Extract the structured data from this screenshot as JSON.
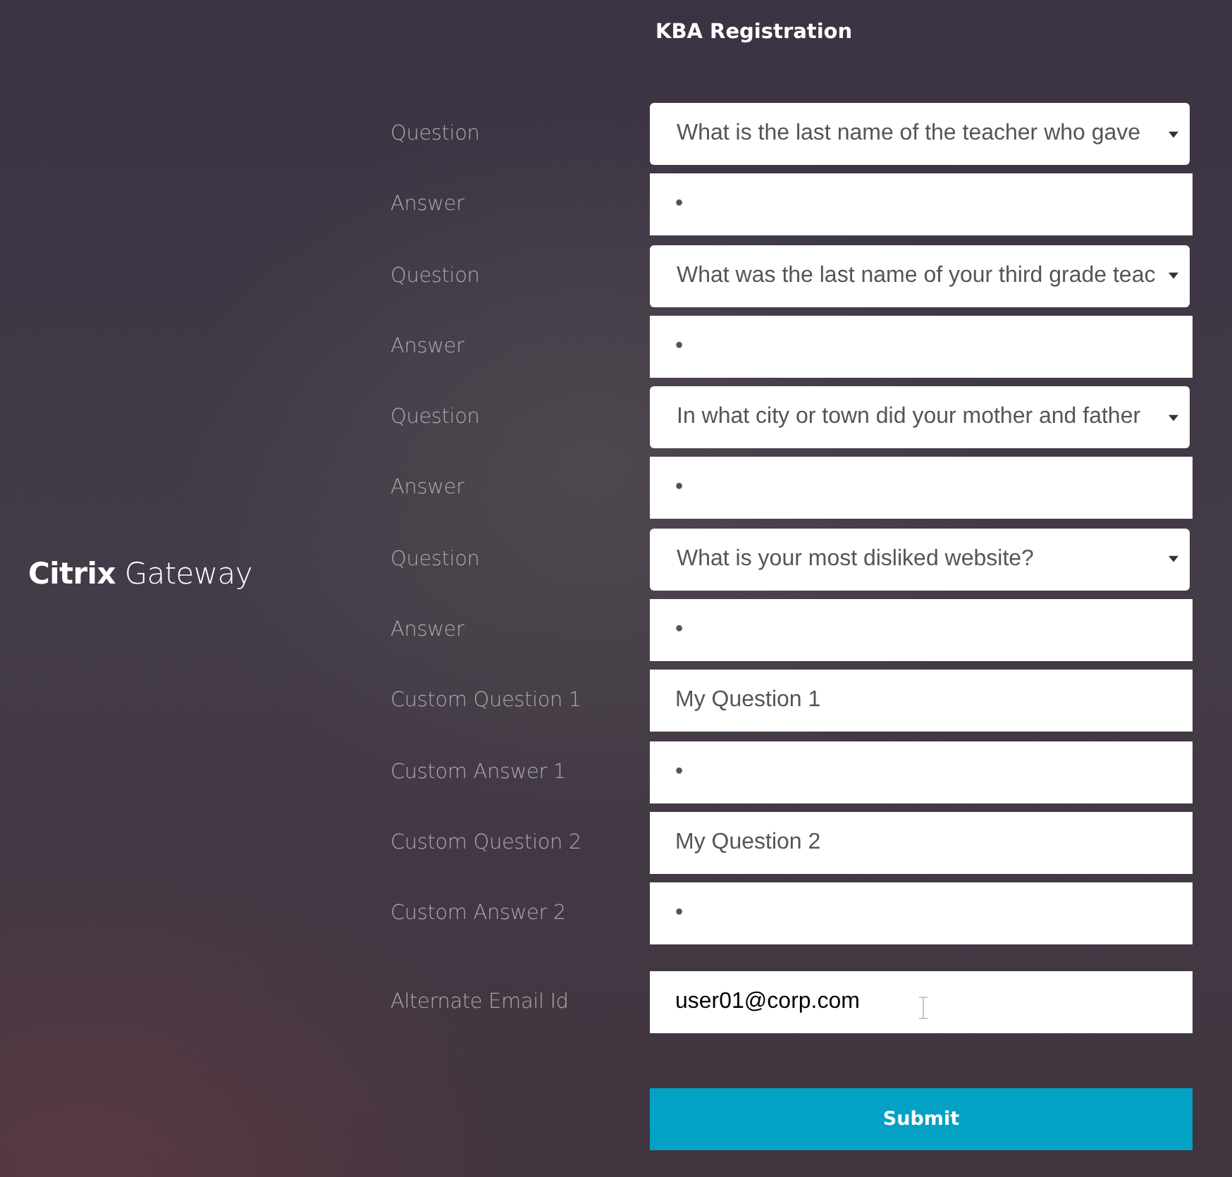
{
  "brand": "**Citrix** Gateway",
  "title": "KBA Registration",
  "fields": [
    {
      "kind": "select",
      "label": "Question",
      "value": "What is the last name of the teacher who gave"
    },
    {
      "kind": "password",
      "label": "Answer",
      "value": "•"
    },
    {
      "kind": "select",
      "label": "Question",
      "value": "What was the last name of your third grade teac"
    },
    {
      "kind": "password",
      "label": "Answer",
      "value": "•"
    },
    {
      "kind": "select",
      "label": "Question",
      "value": "In what city or town did your mother and father"
    },
    {
      "kind": "password",
      "label": "Answer",
      "value": "•"
    },
    {
      "kind": "select",
      "label": "Question",
      "value": "What is your most disliked website?"
    },
    {
      "kind": "password",
      "label": "Answer",
      "value": "•"
    },
    {
      "kind": "text",
      "label": "Custom Question 1",
      "value": "My Question 1"
    },
    {
      "kind": "password",
      "label": "Custom Answer 1",
      "value": "•"
    },
    {
      "kind": "text",
      "label": "Custom Question 2",
      "value": "My Question 2"
    },
    {
      "kind": "password",
      "label": "Custom Answer 2",
      "value": "•"
    },
    {
      "kind": "email",
      "label": "Alternate Email Id",
      "value": "user01@corp.com"
    }
  ],
  "submit": "Submit"
}
